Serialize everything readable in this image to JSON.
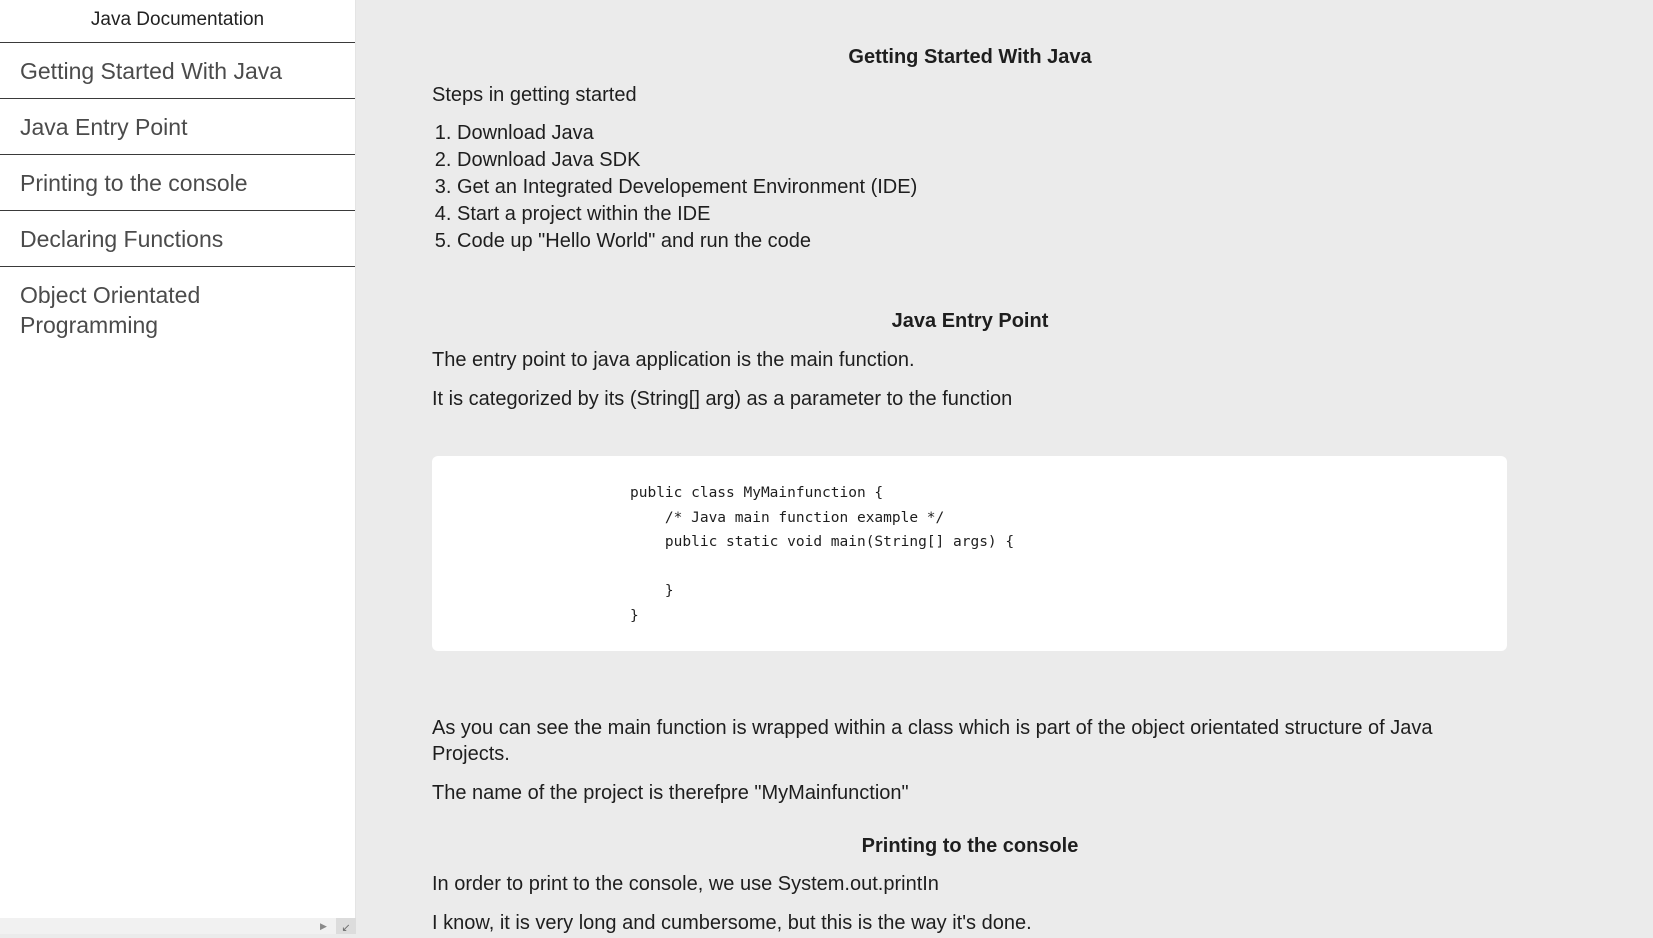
{
  "sidebar": {
    "header": "Java Documentation",
    "items": [
      {
        "label": "Getting Started With Java"
      },
      {
        "label": "Java Entry Point"
      },
      {
        "label": "Printing to the console"
      },
      {
        "label": "Declaring Functions"
      },
      {
        "label": "Object Orientated Programming"
      }
    ]
  },
  "main": {
    "sections": [
      {
        "title": "Getting Started With Java",
        "intro": "Steps in getting started",
        "steps": [
          "Download Java",
          "Download Java SDK",
          "Get an Integrated Developement Environment (IDE)",
          "Start a project within the IDE",
          "Code up \"Hello World\" and run the code"
        ]
      },
      {
        "title": "Java Entry Point",
        "paragraphs": [
          "The entry point to java application is the main function.",
          "It is categorized by its (String[] arg) as a parameter to the function"
        ],
        "code": "public class MyMainfunction {\n    /* Java main function example */\n    public static void main(String[] args) {\n\n    }\n}",
        "after": [
          "As you can see the main function is wrapped within a class which is part of the object orientated structure of Java Projects.",
          "The name of the project is therefpre \"MyMainfunction\""
        ]
      },
      {
        "title": "Printing to the console",
        "paragraphs": [
          "In order to print to the console, we use System.out.printIn",
          "I know, it is very long and cumbersome, but this is the way it's done."
        ]
      }
    ]
  }
}
